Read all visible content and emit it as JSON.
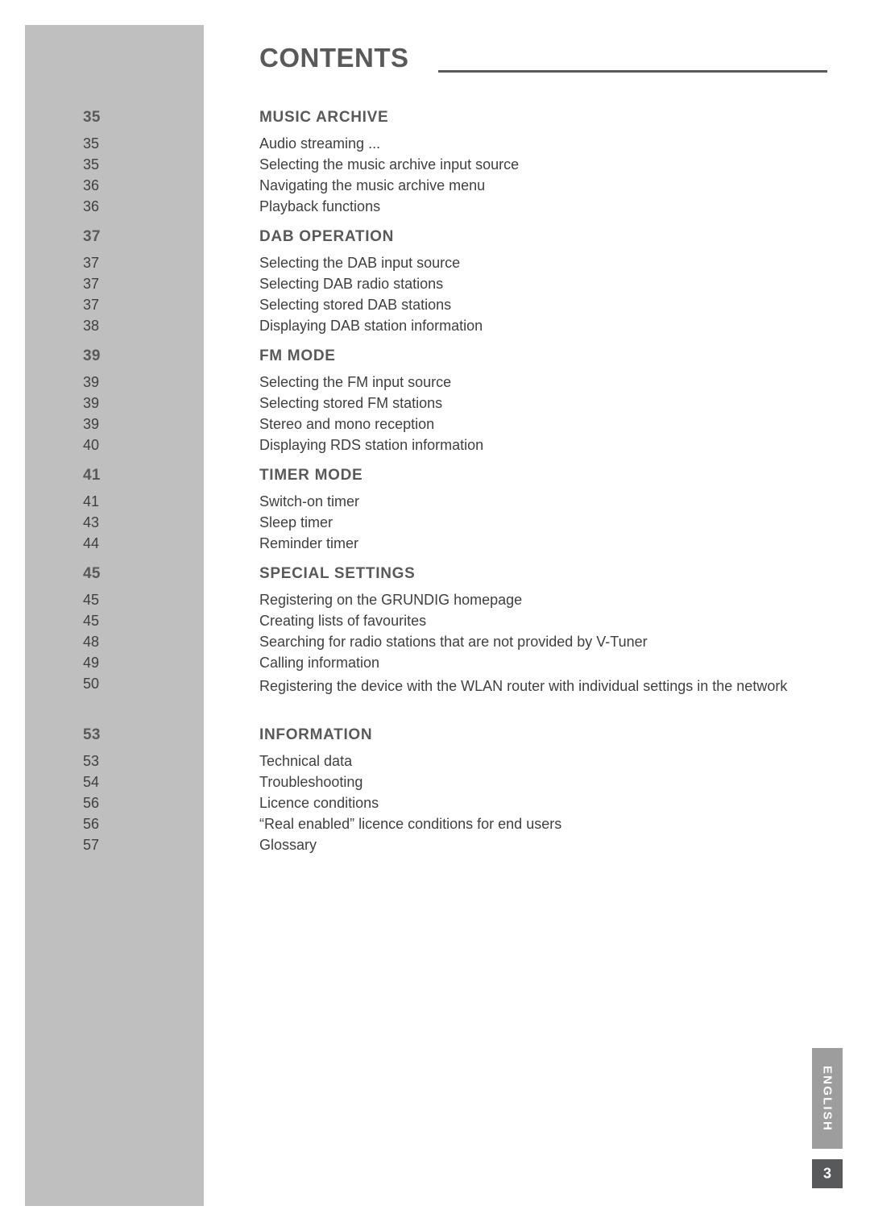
{
  "header": {
    "title": "CONTENTS"
  },
  "sidebar": {
    "language_label": "ENGLISH",
    "page_number": "3"
  },
  "toc": {
    "groups": [
      {
        "page": "35",
        "title": "MUSIC ARCHIVE",
        "entries": [
          {
            "page": "35",
            "text": "Audio streaming ..."
          },
          {
            "page": "35",
            "text": "Selecting the music archive input source"
          },
          {
            "page": "36",
            "text": "Navigating the music archive menu"
          },
          {
            "page": "36",
            "text": "Playback functions"
          }
        ]
      },
      {
        "page": "37",
        "title": "DAB OPERATION",
        "entries": [
          {
            "page": "37",
            "text": "Selecting the DAB input source"
          },
          {
            "page": "37",
            "text": "Selecting DAB radio stations"
          },
          {
            "page": "37",
            "text": "Selecting stored DAB stations"
          },
          {
            "page": "38",
            "text": "Displaying DAB station information"
          }
        ]
      },
      {
        "page": "39",
        "title": "FM MODE",
        "entries": [
          {
            "page": "39",
            "text": "Selecting the FM input source"
          },
          {
            "page": "39",
            "text": "Selecting stored FM stations"
          },
          {
            "page": "39",
            "text": "Stereo and mono reception"
          },
          {
            "page": "40",
            "text": "Displaying RDS station information"
          }
        ]
      },
      {
        "page": "41",
        "title": "TIMER MODE",
        "entries": [
          {
            "page": "41",
            "text": "Switch-on timer"
          },
          {
            "page": "43",
            "text": "Sleep timer"
          },
          {
            "page": "44",
            "text": "Reminder timer"
          }
        ]
      },
      {
        "page": "45",
        "title": "SPECIAL SETTINGS",
        "entries": [
          {
            "page": "45",
            "text": "Registering on the GRUNDIG homepage"
          },
          {
            "page": "45",
            "text": "Creating lists of favourites"
          },
          {
            "page": "48",
            "text": "Searching for radio stations that are not provided by V-Tuner"
          },
          {
            "page": "49",
            "text": "Calling information"
          },
          {
            "page": "50",
            "text": "Registering the device with the WLAN router with individual settings in the network",
            "wrap": true
          }
        ]
      },
      {
        "page": "53",
        "title": "INFORMATION",
        "entries": [
          {
            "page": "53",
            "text": "Technical data"
          },
          {
            "page": "54",
            "text": "Troubleshooting"
          },
          {
            "page": "56",
            "text": "Licence conditions"
          },
          {
            "page": "56",
            "text": "“Real enabled” licence conditions for end users"
          },
          {
            "page": "57",
            "text": "Glossary"
          }
        ]
      }
    ]
  }
}
